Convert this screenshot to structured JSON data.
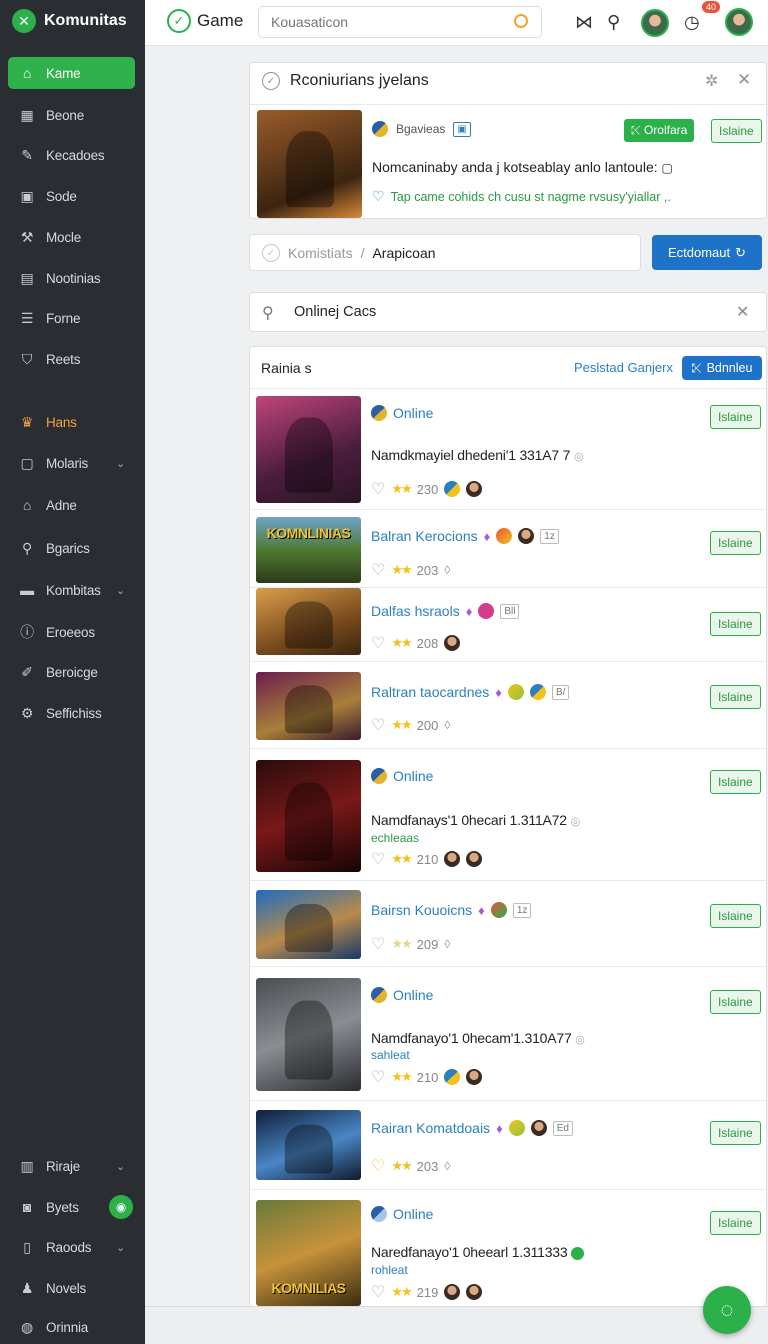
{
  "sidebar": {
    "brand": "Komunitas",
    "items": [
      {
        "label": "Kame",
        "icon": "home-icon"
      },
      {
        "label": "Beone",
        "icon": "grid-icon"
      },
      {
        "label": "Kecadoes",
        "icon": "pencil-icon"
      },
      {
        "label": "Sode",
        "icon": "box-icon"
      },
      {
        "label": "Mocle",
        "icon": "wrench-icon"
      },
      {
        "label": "Nootinias",
        "icon": "card-icon"
      },
      {
        "label": "Forne",
        "icon": "list-icon"
      },
      {
        "label": "Reets",
        "icon": "shield-icon"
      },
      {
        "label": "Hans",
        "icon": "crown-icon"
      },
      {
        "label": "Molaris",
        "icon": "square-icon"
      },
      {
        "label": "Adne",
        "icon": "building-icon"
      },
      {
        "label": "Bgarics",
        "icon": "search-icon"
      },
      {
        "label": "Kombitas",
        "icon": "folder-icon"
      },
      {
        "label": "Eroeeos",
        "icon": "info-circle-icon"
      },
      {
        "label": "Beroicge",
        "icon": "pen-icon"
      },
      {
        "label": "Seffichiss",
        "icon": "gear-icon"
      },
      {
        "label": "Riraje",
        "icon": "bar-chart-icon"
      },
      {
        "label": "Byets",
        "icon": "camera-icon"
      },
      {
        "label": "Raoods",
        "icon": "book-icon"
      },
      {
        "label": "Novels",
        "icon": "user-icon"
      },
      {
        "label": "Orinnia",
        "icon": "user-circle-icon"
      }
    ]
  },
  "topbar": {
    "title": "Game",
    "search_placeholder": "Kouasaticon",
    "notification_count": "40"
  },
  "featured": {
    "header": "Rconiurians jyelans",
    "tag": "Bgavieas",
    "btn_primary": "Orolfara",
    "btn_status": "Islaine",
    "description": "Nomcaninaby anda j kotseablay anlo lantoule:",
    "hint": "Tap came cohids ch cusu st nagme rvsusy'yiallar ,."
  },
  "breadcrumb": {
    "root": "Komistiats",
    "separator": "/",
    "current": "Arapicoan",
    "button": "Ectdomaut"
  },
  "filter": {
    "value": "Onlinej Cacs"
  },
  "list_header": {
    "label": "Rainia s",
    "link": "Peslstad Ganjerx",
    "button": "Bdnnleu"
  },
  "rows": [
    {
      "title": "Online",
      "kind": "full",
      "desc": "Namdkmayiel dhedeni'1 331A7 7",
      "sub": "",
      "count": "230",
      "status": "Islaine",
      "thumb_text": ""
    },
    {
      "title": "Balran Kerocions",
      "kind": "compact",
      "count": "203",
      "box": "1z",
      "status": "Islaine",
      "thumb_text": "KOMNLINIAS"
    },
    {
      "title": "Dalfas hsraols",
      "kind": "compact",
      "count": "208",
      "box": "Bll",
      "status": "Islaine",
      "thumb_text": ""
    },
    {
      "title": "Raltran taocardnes",
      "kind": "compact",
      "count": "200",
      "box": "B/",
      "status": "Islaine",
      "thumb_text": ""
    },
    {
      "title": "Online",
      "kind": "full",
      "desc": "Namdfanays'1 0hecari 1.311A72",
      "sub": "echleaas",
      "sub_color": "green",
      "count": "210",
      "status": "Islaine",
      "thumb_text": ""
    },
    {
      "title": "Bairsn Kouoicns",
      "kind": "compact",
      "count": "209",
      "box": "1z",
      "status": "Islaine",
      "thumb_text": ""
    },
    {
      "title": "Online",
      "kind": "full",
      "desc": "Namdfanayo'1 0hecam'1.310A77",
      "sub": "sahleat",
      "sub_color": "blue",
      "count": "210",
      "status": "Islaine",
      "thumb_text": ""
    },
    {
      "title": "Rairan Komatdoais",
      "kind": "compact",
      "count": "203",
      "box": "Ed",
      "status": "Islaine",
      "thumb_text": ""
    },
    {
      "title": "Online",
      "kind": "full",
      "desc": "Naredfanayo'1 0heearl 1.311333",
      "sub": "rohleat",
      "sub_color": "blue",
      "count": "219",
      "status": "Islaine",
      "thumb_text": "KOMNILIAS"
    }
  ],
  "colors": {
    "accent_green": "#2bb04a",
    "sidebar_bg": "#2a2e33",
    "link_blue": "#2a7fc1",
    "button_blue": "#1e73c8"
  }
}
